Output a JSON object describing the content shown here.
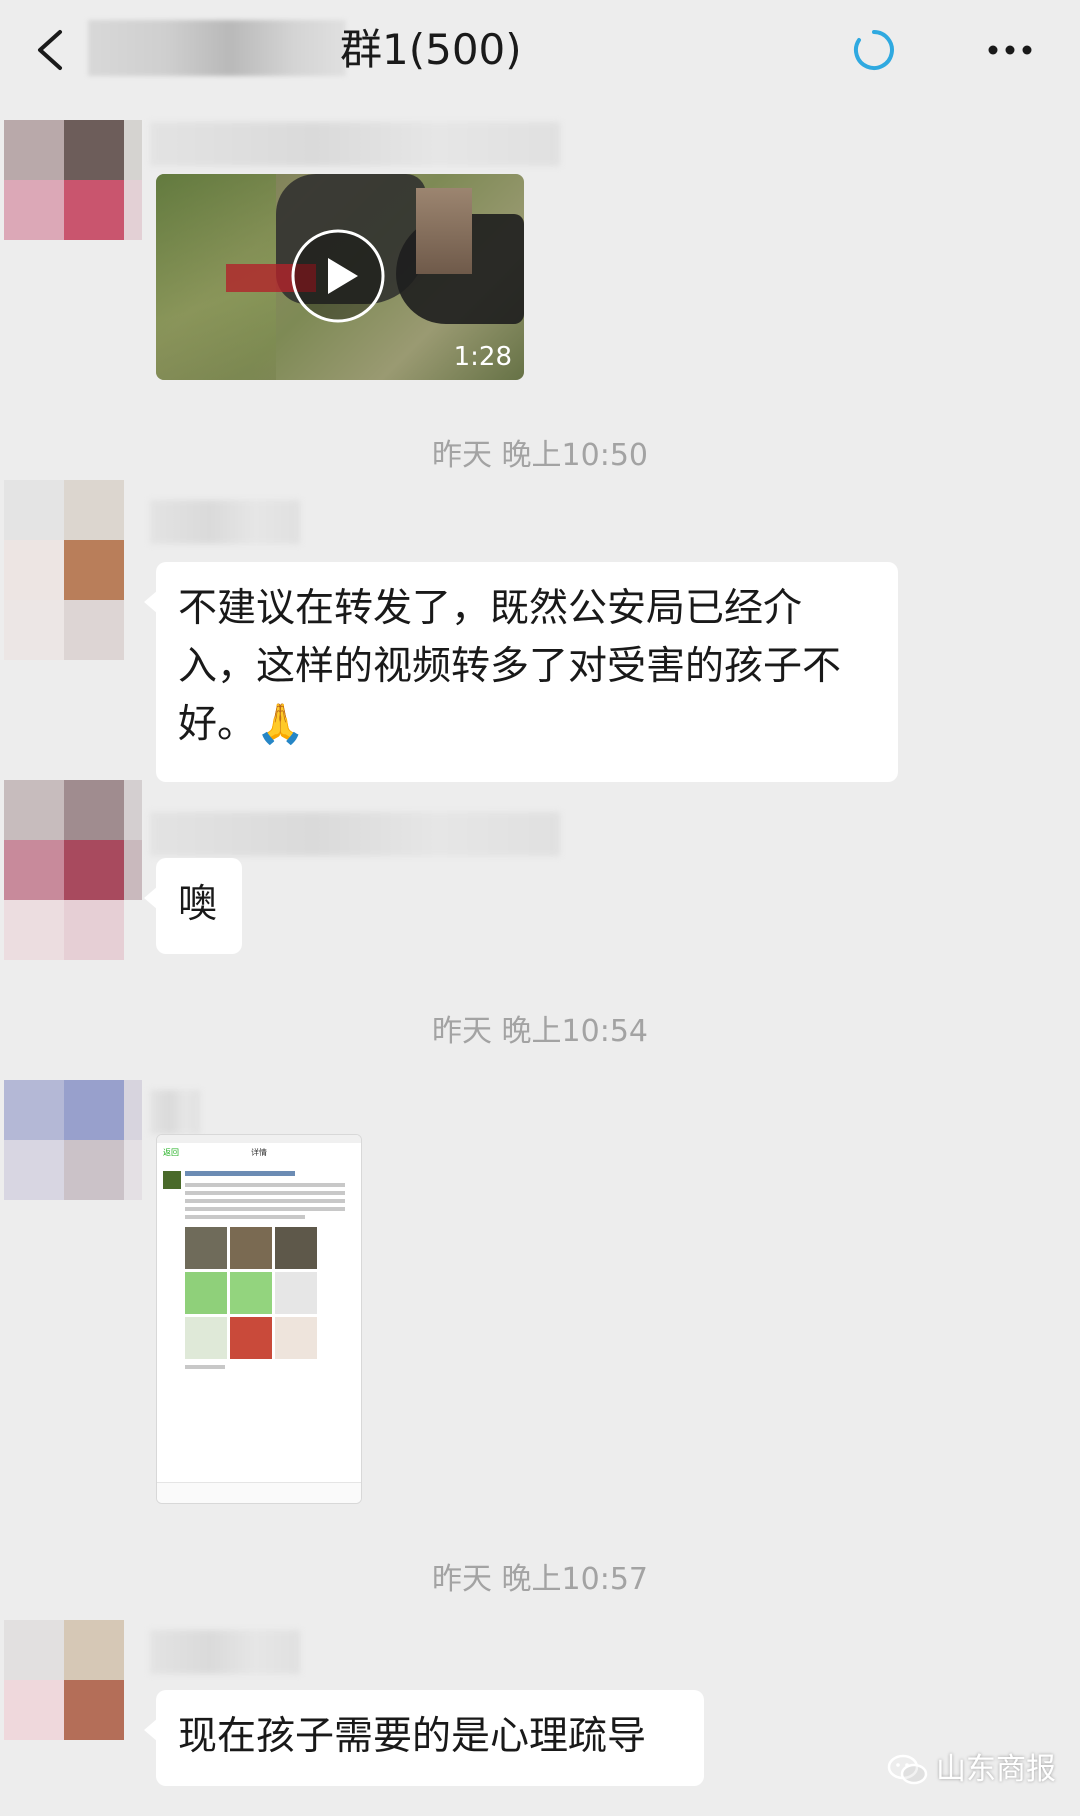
{
  "header": {
    "back_icon": "chevron-left-icon",
    "title_suffix": "群1(500)",
    "status_icon": "loading-ring-icon",
    "more_icon": "more-dots-icon"
  },
  "messages": [
    {
      "type": "video",
      "duration": "1:28"
    },
    {
      "type": "timestamp",
      "text": "昨天 晚上10:50"
    },
    {
      "type": "text",
      "lines": [
        "不建议在转发了，既然公安局已经介",
        "入，这样的视频转多了对受害的孩子不",
        "好。🙏"
      ]
    },
    {
      "type": "text",
      "lines": [
        "噢"
      ]
    },
    {
      "type": "timestamp",
      "text": "昨天 晚上10:54"
    },
    {
      "type": "image",
      "screenshot": {
        "nav_back": "返回",
        "nav_title": "详情"
      }
    },
    {
      "type": "timestamp",
      "text": "昨天 晚上10:57"
    },
    {
      "type": "text",
      "lines": [
        "现在孩子需要的是心理疏导"
      ]
    }
  ],
  "watermark": {
    "text": "山东商报",
    "icon": "wechat-icon"
  },
  "colors": {
    "background": "#ededed",
    "bubble": "#ffffff",
    "timestamp": "#a3a3a3",
    "loading_ring": "#2fa9e0"
  }
}
